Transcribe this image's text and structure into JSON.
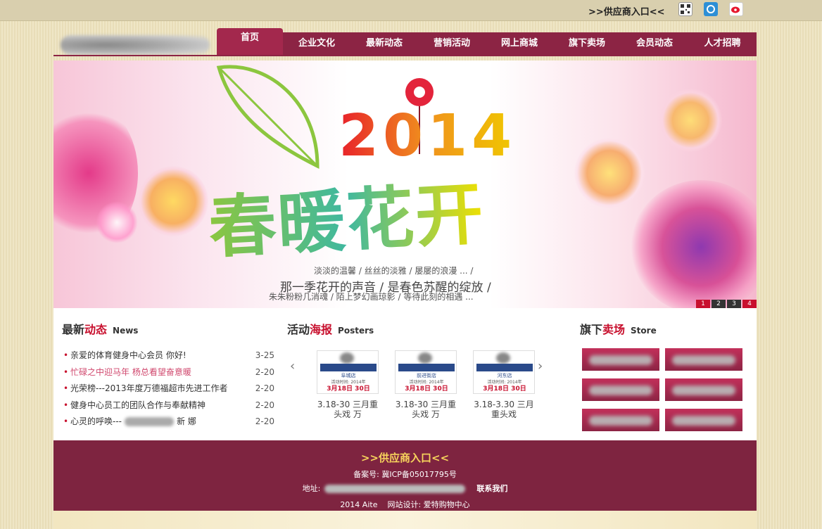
{
  "topbar": {
    "supplier_link": ">>供应商入口<<",
    "icons": [
      "qrcode-icon",
      "tencent-weibo-icon",
      "sina-weibo-icon"
    ]
  },
  "nav": {
    "items": [
      "首页",
      "企业文化",
      "最新动态",
      "营销活动",
      "网上商城",
      "旗下卖场",
      "会员动态",
      "人才招聘"
    ],
    "active_index": 0
  },
  "banner": {
    "year": "2014",
    "slogan": "春暖花开",
    "line1": "淡淡的温馨 / 丝丝的淡雅 / 屡屡的浪漫 ... /",
    "line2": "那一季花开的声音 / 是春色苏醒的绽放 /",
    "line3": "朱朱粉粉几消魂 / 陌上梦幻画琼影 / 等待此刻的相遇 ...",
    "pages": [
      "1",
      "2",
      "3",
      "4"
    ],
    "current_page": 1
  },
  "news": {
    "title_a": "最新",
    "title_b": "动态",
    "title_en": "News",
    "items": [
      {
        "title": "亲爱的体育健身中心会员 你好!",
        "date": "3-25"
      },
      {
        "title": "忙碌之中迎马年 杨总看望奋意暖",
        "date": "2-20"
      },
      {
        "title": "光荣榜---2013年度万德福超市先进工作者",
        "date": "2-20"
      },
      {
        "title": "健身中心员工的团队合作与奉献精神",
        "date": "2-20"
      },
      {
        "title": "心灵的呼唤---",
        "tail": "新 娜",
        "date": "2-20"
      }
    ]
  },
  "posters": {
    "title_a": "活动",
    "title_b": "海报",
    "title_en": "Posters",
    "items": [
      {
        "store": "阜城店",
        "period": "活动时间: 2014年",
        "dates": "3月18日 30日",
        "caption": "3.18-30 三月重头戏 万"
      },
      {
        "store": "前进街店",
        "period": "活动时间: 2014年",
        "dates": "3月18日 30日",
        "caption": "3.18-30 三月重头戏 万"
      },
      {
        "store": "河东店",
        "period": "活动时间: 2014年",
        "dates": "3月18日 30日",
        "caption": "3.18-3.30 三月重头戏"
      }
    ]
  },
  "stores": {
    "title_a": "旗下",
    "title_b": "卖场",
    "title_en": "Store",
    "count": 6
  },
  "footer": {
    "supplier": ">>供应商入口<<",
    "icp": "备案号: 冀ICP备05017795号",
    "address_label": "地址:",
    "contact": "联系我们",
    "copyright": "2014 Aite",
    "design": "网站设计: 爱特购物中心"
  },
  "colors": {
    "brand": "#8c2444",
    "accent": "#c8102e",
    "footer": "#7e2440",
    "supplier_link": "#f7d45c"
  }
}
